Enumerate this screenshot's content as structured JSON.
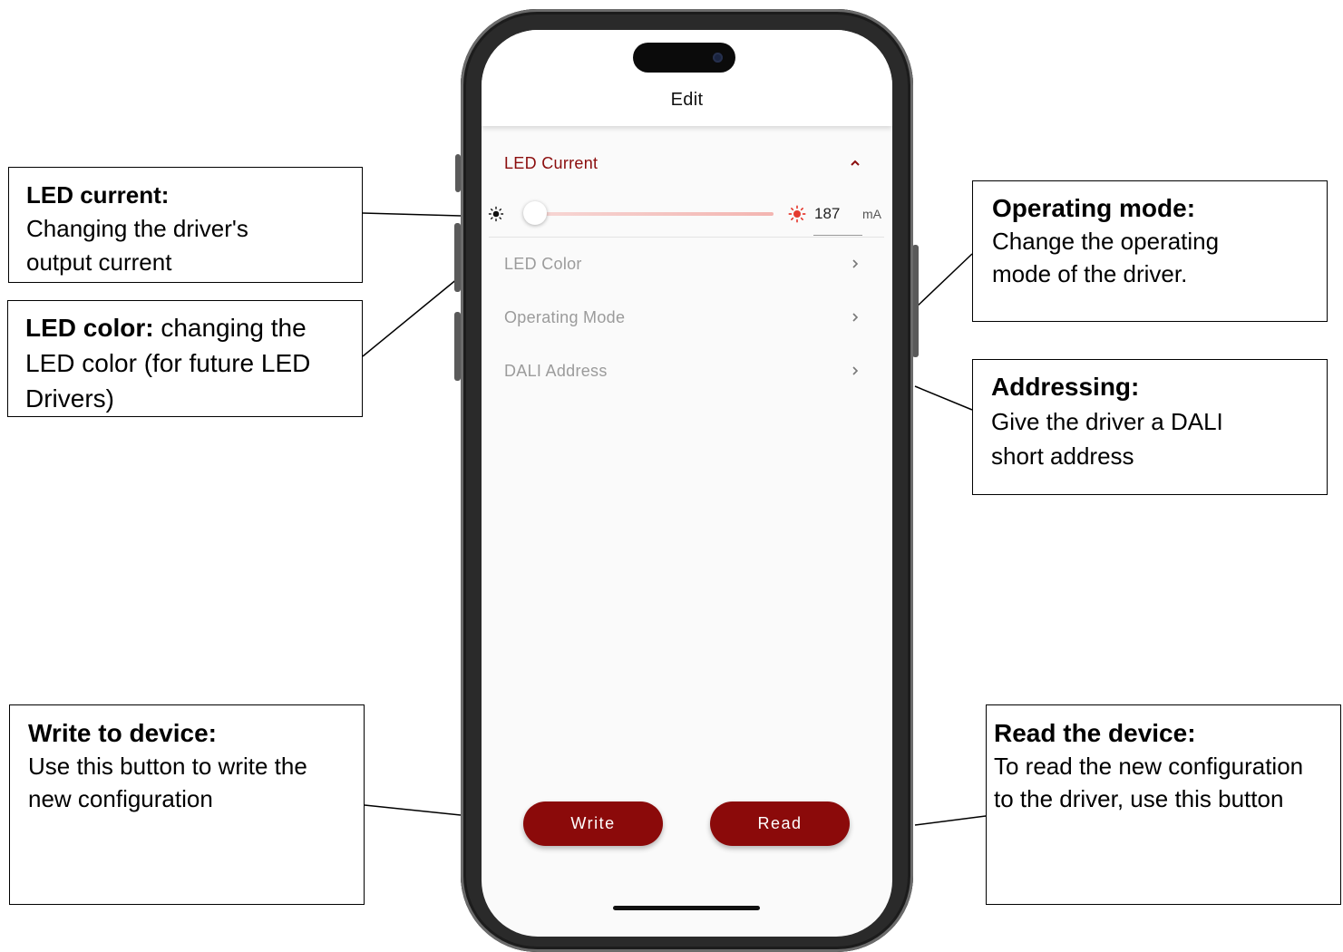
{
  "colors": {
    "accent": "#8b0a0a",
    "muted_text": "#9b9b9b",
    "slider_track": "#f3b5b1"
  },
  "callouts": {
    "led_current": {
      "title": "LED current:",
      "body": "Changing the driver's output current"
    },
    "led_color": {
      "title": "LED color:",
      "body": " changing the LED color (for future LED Drivers)"
    },
    "operating_mode": {
      "title": "Operating mode:",
      "body": "Change the operating mode of the driver."
    },
    "addressing": {
      "title": "Addressing:",
      "body": "Give the driver a DALI short address"
    },
    "write": {
      "title": "Write to device:",
      "body": "Use this button to write the new configuration"
    },
    "read": {
      "title": "Read the device:",
      "body": "To read the new configuration to the driver, use this button"
    }
  },
  "app": {
    "header": {
      "title": "Edit"
    },
    "led_current": {
      "label": "LED Current",
      "expanded": true,
      "value": "187",
      "unit": "mA",
      "slider_fraction": 0.0,
      "min_icon": "sun-small-icon",
      "max_icon": "sun-red-icon"
    },
    "menu": [
      {
        "label": "LED Color",
        "icon": "chevron-right-icon"
      },
      {
        "label": "Operating Mode",
        "icon": "chevron-right-icon"
      },
      {
        "label": "DALI Address",
        "icon": "chevron-right-icon"
      }
    ],
    "buttons": {
      "write": "Write",
      "read": "Read"
    }
  }
}
